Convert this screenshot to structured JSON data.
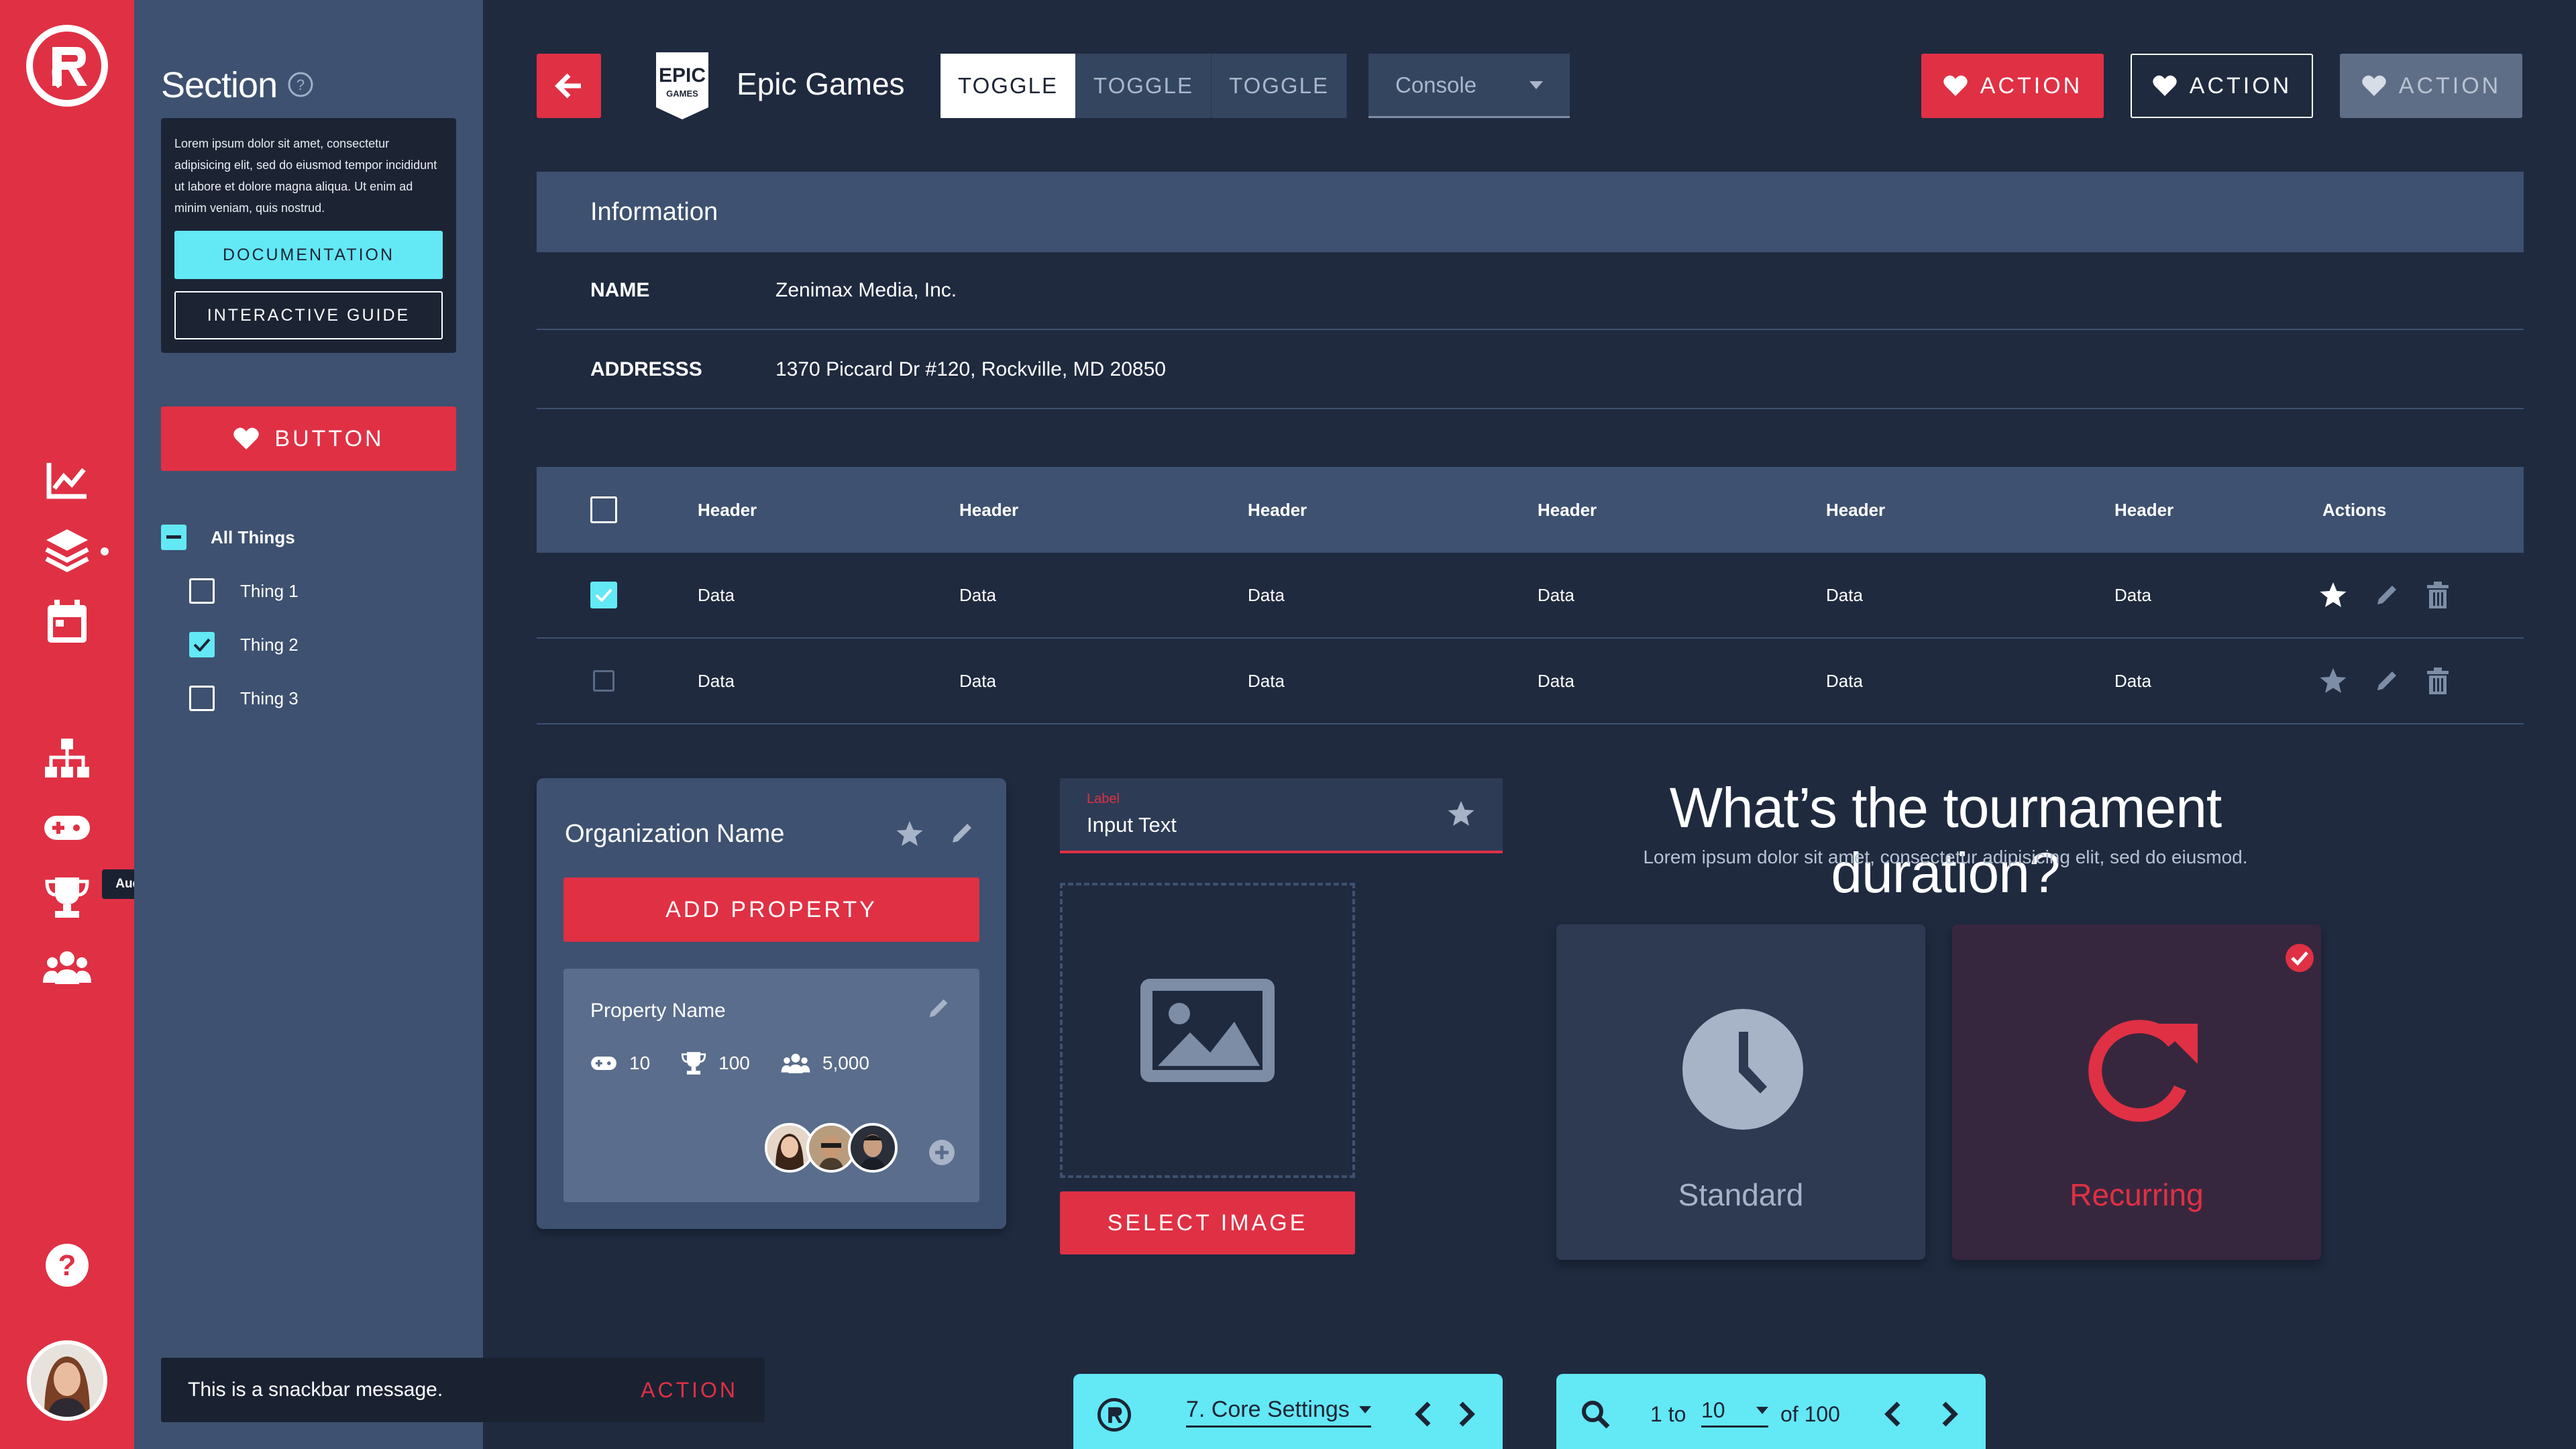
{
  "sidebar": {
    "tooltip": "Audience",
    "icons": [
      "logo-icon",
      "analytics-icon",
      "layers-icon",
      "calendar-icon",
      "hierarchy-icon",
      "gamepad-icon",
      "trophy-icon",
      "users-icon",
      "help-icon"
    ]
  },
  "panel": {
    "title": "Section",
    "info_text": "Lorem ipsum dolor sit amet, consectetur adipisicing elit, sed do eiusmod tempor incididunt ut labore et dolore magna aliqua. Ut enim ad minim veniam, quis nostrud.",
    "documentation_label": "DOCUMENTATION",
    "guide_label": "INTERACTIVE GUIDE",
    "button_label": "BUTTON",
    "tree": {
      "parent": "All Things",
      "children": [
        {
          "label": "Thing 1",
          "checked": false
        },
        {
          "label": "Thing 2",
          "checked": true
        },
        {
          "label": "Thing 3",
          "checked": false
        }
      ]
    }
  },
  "header": {
    "company_logo_line1": "EPIC",
    "company_logo_line2": "GAMES",
    "company_name": "Epic Games",
    "toggles": [
      "TOGGLE",
      "TOGGLE",
      "TOGGLE"
    ],
    "select_value": "Console",
    "actions": [
      "ACTION",
      "ACTION",
      "ACTION"
    ]
  },
  "information": {
    "title": "Information",
    "rows": [
      {
        "key": "NAME",
        "value": "Zenimax Media, Inc."
      },
      {
        "key": "ADDRESSS",
        "value": "1370 Piccard Dr #120, Rockville, MD 20850"
      }
    ]
  },
  "table": {
    "headers": [
      "Header",
      "Header",
      "Header",
      "Header",
      "Header",
      "Header"
    ],
    "actions_header": "Actions",
    "rows": [
      {
        "checked": true,
        "cells": [
          "Data",
          "Data",
          "Data",
          "Data",
          "Data",
          "Data"
        ]
      },
      {
        "checked": false,
        "cells": [
          "Data",
          "Data",
          "Data",
          "Data",
          "Data",
          "Data"
        ]
      }
    ]
  },
  "org_card": {
    "title": "Organization Name",
    "add_label": "ADD PROPERTY",
    "property": {
      "name": "Property Name",
      "games": "10",
      "trophies": "100",
      "users": "5,000"
    }
  },
  "input": {
    "label": "Label",
    "value": "Input Text"
  },
  "image_upload": {
    "button_label": "SELECT IMAGE"
  },
  "question": {
    "title": "What’s the tournament duration?",
    "subtitle": "Lorem ipsum dolor sit amet, consectetur adipisicing elit, sed do eiusmod.",
    "options": [
      {
        "label": "Standard",
        "selected": false
      },
      {
        "label": "Recurring",
        "selected": true
      }
    ]
  },
  "snackbar": {
    "message": "This is a snackbar message.",
    "action": "ACTION"
  },
  "settings_bar": {
    "value": "7. Core Settings"
  },
  "pagination": {
    "prefix": "1 to",
    "per_page": "10",
    "suffix": "of 100"
  },
  "colors": {
    "accent": "#e03044",
    "cyan": "#63e8f5",
    "background": "#1f2a3f",
    "panel": "#3e5170"
  }
}
